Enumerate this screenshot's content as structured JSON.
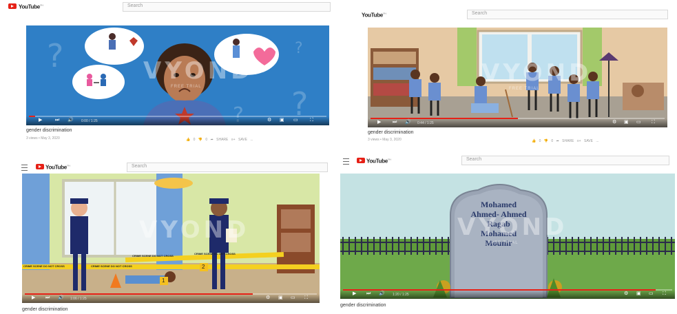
{
  "header": {
    "brand": "YouTube",
    "brand_suffix": "PH",
    "search_placeholder": "Search"
  },
  "watermark": {
    "text": "VYOND",
    "sub": "FREE TRIAL"
  },
  "panels": [
    {
      "title": "gender discrimination",
      "meta": "3 views • May 3, 2020",
      "time": "0:00 / 1:25",
      "progress": 0.02,
      "actions": "👍 0 👎 0 ➦ SHARE ≡+ SAVE ..."
    },
    {
      "title": "gender discrimination",
      "meta": "3 views • May 3, 2020",
      "time": "0:44 / 1:25",
      "progress": 0.5,
      "actions": "👍 0 👎 0 ➦ SHARE ≡+ SAVE ..."
    },
    {
      "title": "gender discrimination",
      "meta": "",
      "time": "1:06 / 1:25",
      "progress": 0.78,
      "actions": "",
      "tape": "CRIME SCENE DO NOT CROSS",
      "markers": [
        "1",
        "2"
      ]
    },
    {
      "title": "gender discrimination",
      "meta": "",
      "time": "1:20 / 1:25",
      "progress": 0.95,
      "actions": "",
      "tombstone": [
        "Mohamed",
        "Ahmed- Ahmed",
        "Ragab",
        "Mohamed",
        "Mounir"
      ]
    }
  ]
}
